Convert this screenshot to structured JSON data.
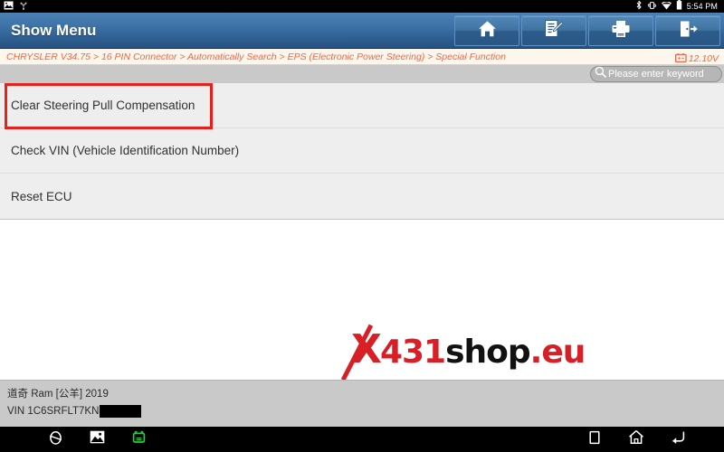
{
  "status_bar": {
    "time": "5:54 PM",
    "left_icons": [
      "screenshot-image-icon",
      "usb-debug-icon"
    ],
    "right_icons": [
      "bluetooth-icon",
      "auto-rotate-icon",
      "wifi-icon",
      "battery-icon"
    ]
  },
  "title_bar": {
    "title": "Show Menu",
    "buttons": [
      {
        "name": "home",
        "icon": "home-icon"
      },
      {
        "name": "edit",
        "icon": "edit-note-icon"
      },
      {
        "name": "print",
        "icon": "printer-icon"
      },
      {
        "name": "exit",
        "icon": "exit-door-icon"
      }
    ]
  },
  "breadcrumb": {
    "path": "CHRYSLER V34.75 > 16 PIN Connector > Automatically Search > EPS (Electronic Power Steering) > Special Function",
    "segments": [
      "CHRYSLER V34.75",
      "16 PIN Connector",
      "Automatically Search",
      "EPS (Electronic Power Steering)",
      "Special Function"
    ],
    "voltage": "12.10V",
    "voltage_icon": "battery-voltage-icon",
    "accent_color": "#f26544"
  },
  "search": {
    "placeholder": "Please enter keyword",
    "icon": "search-icon",
    "value": ""
  },
  "menu": {
    "items": [
      {
        "label": "Clear Steering Pull Compensation",
        "selected": true
      },
      {
        "label": "Check VIN (Vehicle Identification Number)",
        "selected": false
      },
      {
        "label": "Reset ECU",
        "selected": false
      }
    ],
    "highlight_color": "#e8201c"
  },
  "watermark": {
    "x": "X",
    "num": "431",
    "shop": "shop",
    "tld": ".eu",
    "red": "#d81f26",
    "black": "#111111"
  },
  "vehicle_info": {
    "model": "道奇 Ram [公羊] 2019",
    "vin_label": "VIN",
    "vin_value": "1C6SRFLT7KN8",
    "vin_redacted": true
  },
  "nav_bar": {
    "items": [
      {
        "name": "screenshot",
        "icon": "screenshot-icon"
      },
      {
        "name": "gallery",
        "icon": "image-icon"
      },
      {
        "name": "vci-connection",
        "icon": "vci-icon"
      },
      {
        "name": "recents",
        "icon": "recents-square-icon"
      },
      {
        "name": "home",
        "icon": "home-outline-icon"
      },
      {
        "name": "back",
        "icon": "back-arrow-icon"
      }
    ]
  }
}
